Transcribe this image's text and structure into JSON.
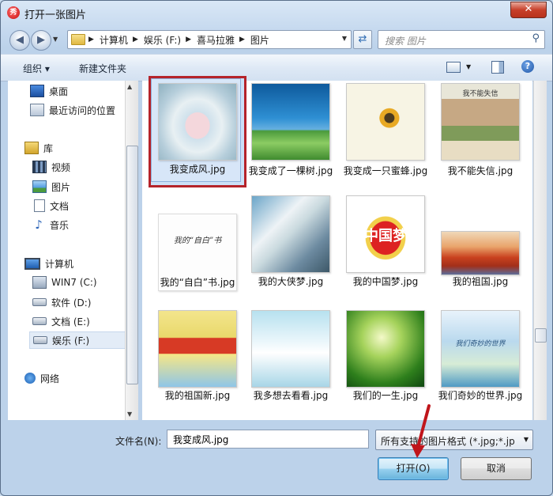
{
  "window": {
    "title": "打开一张图片",
    "app_icon": "app-logo-icon",
    "close_label": "✕"
  },
  "navbar": {
    "breadcrumbs": [
      "计算机",
      "娱乐 (F:)",
      "喜马拉雅",
      "图片"
    ],
    "search_placeholder": "搜索 图片"
  },
  "toolbar": {
    "organize": "组织 ▾",
    "new_folder": "新建文件夹"
  },
  "sidebar": {
    "items": [
      {
        "label": "桌面",
        "icon": "desktop-icon"
      },
      {
        "label": "最近访问的位置",
        "icon": "recent-places-icon"
      },
      {
        "label": "库",
        "icon": "library-icon"
      },
      {
        "label": "视频",
        "icon": "video-icon"
      },
      {
        "label": "图片",
        "icon": "pictures-icon"
      },
      {
        "label": "文档",
        "icon": "documents-icon"
      },
      {
        "label": "音乐",
        "icon": "music-icon"
      },
      {
        "label": "计算机",
        "icon": "computer-icon"
      },
      {
        "label": "WIN7 (C:)",
        "icon": "drive-c-icon"
      },
      {
        "label": "软件 (D:)",
        "icon": "drive-d-icon"
      },
      {
        "label": "文档 (E:)",
        "icon": "drive-e-icon"
      },
      {
        "label": "娱乐 (F:)",
        "icon": "drive-f-icon",
        "selected": true
      },
      {
        "label": "网络",
        "icon": "network-icon"
      }
    ]
  },
  "files": [
    {
      "name": "我变成风.jpg",
      "selected": true
    },
    {
      "name": "我变成了一棵树.jpg"
    },
    {
      "name": "我变成一只蜜蜂.jpg"
    },
    {
      "name": "我不能失信.jpg",
      "thumb_text": "我不能失信"
    },
    {
      "name": "我的“自白”书.jpg",
      "thumb_text": "我的“自白”书"
    },
    {
      "name": "我的大侠梦.jpg"
    },
    {
      "name": "我的中国梦.jpg",
      "thumb_text": "中国梦"
    },
    {
      "name": "我的祖国.jpg"
    },
    {
      "name": "我的祖国新.jpg"
    },
    {
      "name": "我多想去看看.jpg"
    },
    {
      "name": "我们的一生.jpg"
    },
    {
      "name": "我们奇妙的世界.jpg",
      "thumb_text": "我们奇妙的世界"
    }
  ],
  "bottom": {
    "filename_label": "文件名(N):",
    "filename_value": "我变成风.jpg",
    "filetype_value": "所有支持的图片格式 (*.jpg;*.jp",
    "open_button": "打开(O)",
    "cancel_button": "取消"
  },
  "colors": {
    "selection_highlight": "#b5232a",
    "annotation_arrow": "#c0151b"
  }
}
